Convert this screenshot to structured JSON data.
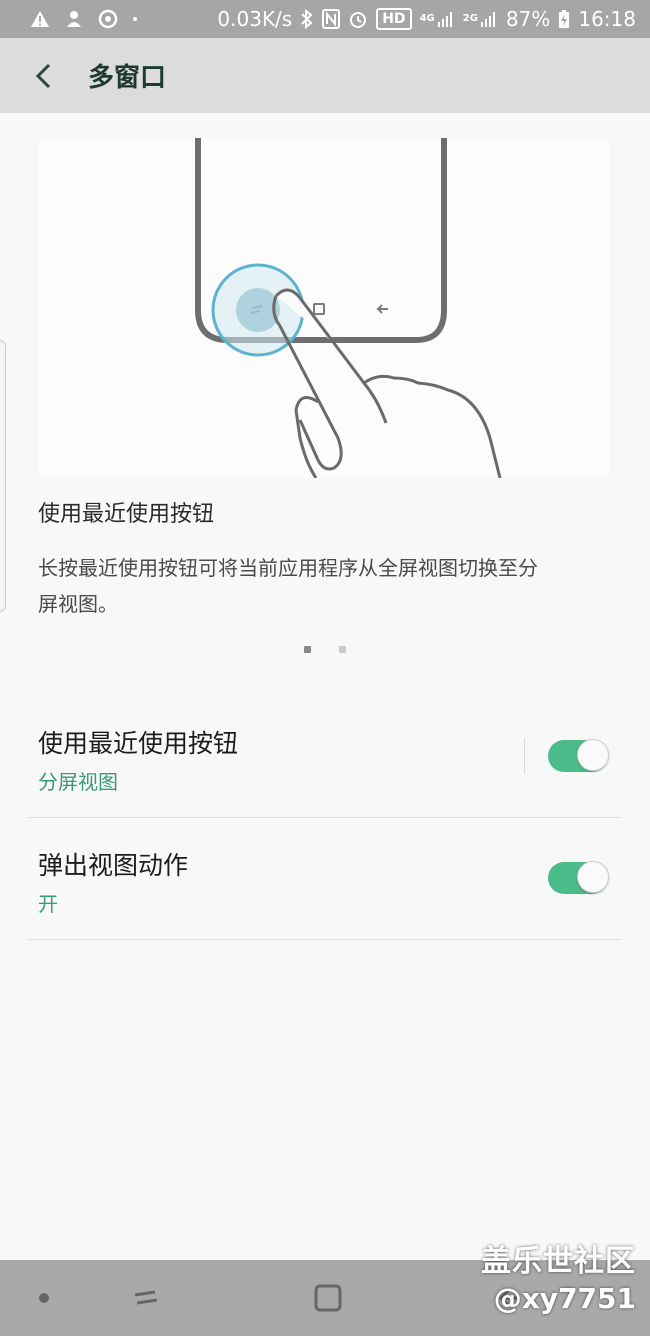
{
  "status_bar": {
    "net_speed": "0.03K/s",
    "hd": "HD",
    "net_4g": "4G",
    "net_2g": "2G",
    "battery": "87%",
    "time": "16:18"
  },
  "app_bar": {
    "title": "多窗口"
  },
  "illustration": {
    "title": "使用最近使用按钮",
    "description": "长按最近使用按钮可将当前应用程序从全屏视图切换至分屏视图。"
  },
  "settings": [
    {
      "title": "使用最近使用按钮",
      "subtitle": "分屏视图",
      "enabled": true
    },
    {
      "title": "弹出视图动作",
      "subtitle": "开",
      "enabled": true
    }
  ],
  "watermark": {
    "line1": "盖乐世社区",
    "line2": "@xy7751"
  },
  "colors": {
    "accent": "#4cbb8a",
    "subtitle": "#3a9c76",
    "status_bar": "#a6a6a6"
  }
}
